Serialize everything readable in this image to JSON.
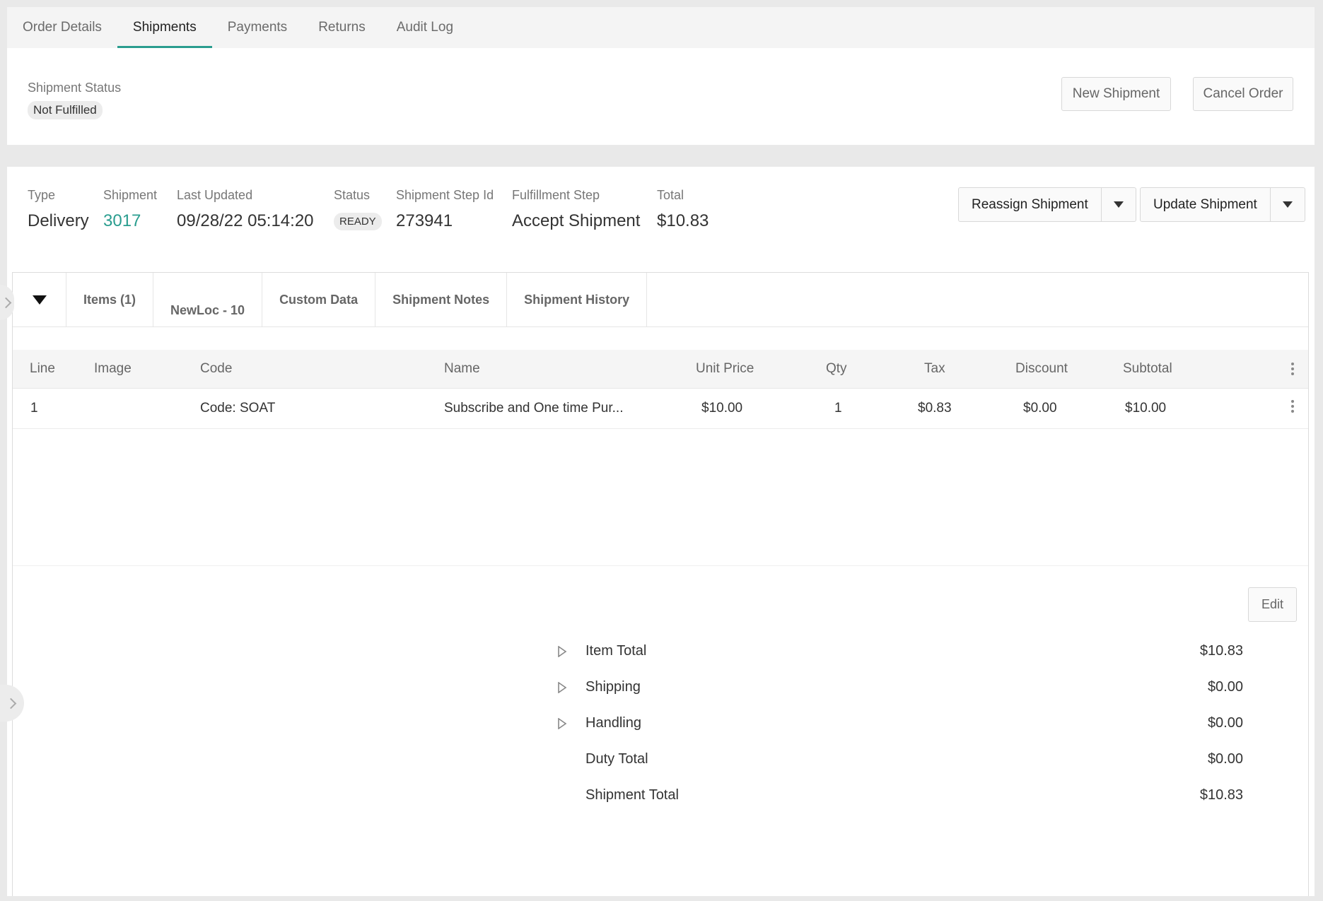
{
  "tabs": [
    {
      "label": "Order Details"
    },
    {
      "label": "Shipments"
    },
    {
      "label": "Payments"
    },
    {
      "label": "Returns"
    },
    {
      "label": "Audit Log"
    }
  ],
  "shipment_status": {
    "label": "Shipment Status",
    "value": "Not Fulfilled"
  },
  "buttons": {
    "new_shipment": "New Shipment",
    "cancel_order": "Cancel Order",
    "reassign_shipment": "Reassign Shipment",
    "update_shipment": "Update Shipment",
    "edit": "Edit"
  },
  "shipment": {
    "type_label": "Type",
    "type": "Delivery",
    "shipment_label": "Shipment",
    "shipment": "3017",
    "updated_label": "Last Updated",
    "updated": "09/28/22 05:14:20",
    "status_label": "Status",
    "status": "READY",
    "step_id_label": "Shipment Step Id",
    "step_id": "273941",
    "step_label": "Fulfillment Step",
    "step": "Accept Shipment",
    "total_label": "Total",
    "total": "$10.83"
  },
  "subtabs": [
    {
      "label": "Items (1)"
    },
    {
      "label": "NewLoc - 10"
    },
    {
      "label": "Custom Data"
    },
    {
      "label": "Shipment Notes"
    },
    {
      "label": "Shipment History"
    }
  ],
  "table": {
    "headers": [
      "Line",
      "Image",
      "Code",
      "Name",
      "Unit Price",
      "Qty",
      "Tax",
      "Discount",
      "Subtotal"
    ],
    "rows": [
      [
        "1",
        "",
        "Code: SOAT",
        "Subscribe and One time Pur...",
        "$10.00",
        "1",
        "$0.83",
        "$0.00",
        "$10.00"
      ]
    ]
  },
  "summary": [
    {
      "label": "Item Total",
      "amount": "$10.83"
    },
    {
      "label": "Shipping",
      "amount": "$0.00"
    },
    {
      "label": "Handling",
      "amount": "$0.00"
    },
    {
      "label": "Duty Total",
      "amount": "$0.00"
    },
    {
      "label": "Shipment Total",
      "amount": "$10.83"
    }
  ],
  "colors": {
    "accent": "#2a9d8f"
  }
}
